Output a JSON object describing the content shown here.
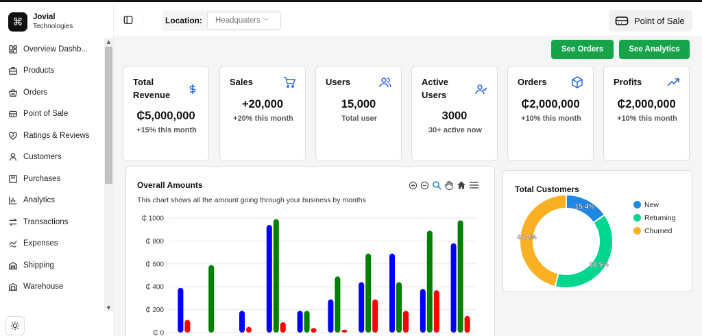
{
  "brand": {
    "logo_glyph": "⌘",
    "name": "Jovial",
    "subtitle": "Technologies"
  },
  "sidebar": {
    "items": [
      {
        "label": "Overview Dashb...",
        "icon": "dashboard-icon"
      },
      {
        "label": "Products",
        "icon": "briefcase-icon"
      },
      {
        "label": "Orders",
        "icon": "basket-icon"
      },
      {
        "label": "Point of Sale",
        "icon": "register-icon"
      },
      {
        "label": "Ratings & Reviews",
        "icon": "heart-icon"
      },
      {
        "label": "Customers",
        "icon": "user-icon"
      },
      {
        "label": "Purchases",
        "icon": "purchases-icon"
      },
      {
        "label": "Analytics",
        "icon": "bar-chart-icon"
      },
      {
        "label": "Transactions",
        "icon": "transfer-icon"
      },
      {
        "label": "Expenses",
        "icon": "expenses-icon"
      },
      {
        "label": "Shipping",
        "icon": "shipping-icon"
      },
      {
        "label": "Warehouse",
        "icon": "warehouse-icon"
      }
    ]
  },
  "header": {
    "location_label": "Location:",
    "location_value": "Headquaters",
    "pos_button": "Point of Sale"
  },
  "actions": {
    "see_orders": "See Orders",
    "see_analytics": "See Analytics"
  },
  "cards": [
    {
      "title": "Total Revenue",
      "value": "₵5,000,000",
      "sub": "+15% this month",
      "icon": "dollar-icon",
      "accent": "#2563eb"
    },
    {
      "title": "Sales",
      "value": "+20,000",
      "sub": "+20% this month",
      "icon": "cart-icon",
      "accent": "#2563eb"
    },
    {
      "title": "Users",
      "value": "15,000",
      "sub": "Total user",
      "icon": "users-icon",
      "accent": "#2563eb"
    },
    {
      "title": "Active Users",
      "value": "3000",
      "sub": "30+ active now",
      "icon": "user-check-icon",
      "accent": "#2563eb"
    },
    {
      "title": "Orders",
      "value": "₵2,000,000",
      "sub": "+10% this month",
      "icon": "box-icon",
      "accent": "#2563eb"
    },
    {
      "title": "Profits",
      "value": "₵2,000,000",
      "sub": "+10% this month",
      "icon": "trending-up-icon",
      "accent": "#2563eb"
    }
  ],
  "overall": {
    "title": "Overall Amounts",
    "description": "This chart shows all the amount going through your business by months"
  },
  "customers_panel": {
    "title": "Total Customers"
  },
  "chart_data": [
    {
      "type": "bar",
      "yticks": [
        "₵ 0",
        "₵ 200",
        "₵ 400",
        "₵ 600",
        "₵ 800",
        "₵ 1000"
      ],
      "ylim": [
        0,
        1000
      ],
      "grid": true,
      "series": [
        {
          "color": "#0000ff",
          "values": [
            390,
            0,
            190,
            940,
            190,
            290,
            440,
            690,
            380,
            780
          ]
        },
        {
          "color": "#008000",
          "values": [
            0,
            590,
            0,
            990,
            190,
            490,
            690,
            440,
            890,
            980
          ]
        },
        {
          "color": "#ff0000",
          "values": [
            110,
            0,
            50,
            90,
            40,
            25,
            290,
            190,
            370,
            145
          ]
        }
      ],
      "bar_layout": "per-month groups; blue and green swap order in some groups"
    },
    {
      "type": "pie",
      "donut": true,
      "legend_position": "right",
      "labels": [
        "New",
        "Returning",
        "Churned"
      ],
      "values": [
        15.4,
        38.5,
        46.2
      ],
      "value_labels": [
        "15.4%",
        "38.5%",
        "46.2%"
      ],
      "colors": [
        "#1e88e5",
        "#00d68f",
        "#fbb023"
      ]
    }
  ]
}
